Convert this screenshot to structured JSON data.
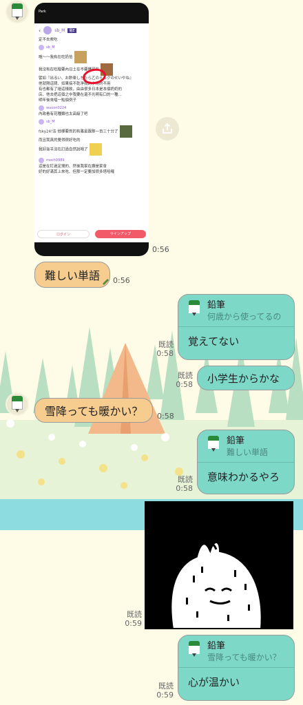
{
  "messages": {
    "shared_screenshot_time": "0:56",
    "msg1_text": "難しい単語",
    "msg1_time": "0:56",
    "reply1": {
      "name": "鉛筆",
      "quote": "何歳から使ってるの",
      "body": "覚えてない",
      "read": "既読",
      "time": "0:58"
    },
    "msg2": {
      "text": "小学生からかな",
      "read": "既読",
      "time": "0:58"
    },
    "msg3": {
      "text": "雪降っても暖かい？",
      "time": "0:58"
    },
    "reply2": {
      "name": "鉛筆",
      "quote": "難しい単語",
      "body": "意味わかるやろ",
      "read": "既読",
      "time": "0:58"
    },
    "image_msg": {
      "read": "既読",
      "time": "0:59"
    },
    "reply3": {
      "name": "鉛筆",
      "quote": "雪降っても暖かい？",
      "body": "心が温かい",
      "read": "既読",
      "time": "0:59"
    }
  },
  "embedded_screenshot": {
    "topbar": "Park",
    "username": "sb_M",
    "badge": "電E",
    "lines": [
      "定不去救吃",
      "哦～～我有在吃奶恰",
      "我沒有在吃橙要內日土在不要獲得的",
      "譬如『出るい、お酢楽しちたら乙のミルクのせいやね』",
      "他就剛這問、如果搞不乾淨我的小時的不用",
      "有也都有了絕這樣飲，由由很多日本是本個奶奶的",
      "店、他去把這個之中我要在還不光明有口的一種...",
      "明年後來唱一點個例子"
    ],
    "users": [
      "wuoon0224",
      "sb_M",
      "fsky2415",
      "moch0989"
    ],
    "more_lines": [
      "內政看有花種類也太高級了吧",
      "fsky24!法 他哪要到的有雅是跟那一百三十分了",
      "而且我真的覺得很好吃的",
      "我好捨羊沒在訂過自然說喝了",
      "這是在訂過定搜的、然後我家在讚是家會",
      "好的好滿其上來吃、但那一定要加很多塔哈囉"
    ],
    "login": "ログイン",
    "signup": "サインアップ"
  },
  "colors": {
    "background": "#fefbe6",
    "incoming_bubble": "#f6cc8f",
    "outgoing_bubble": "#7dd8c8"
  },
  "icons": [
    "pencil-avatar-icon",
    "share-icon",
    "pencil-sticker-icon",
    "pencil-reply-icon"
  ]
}
